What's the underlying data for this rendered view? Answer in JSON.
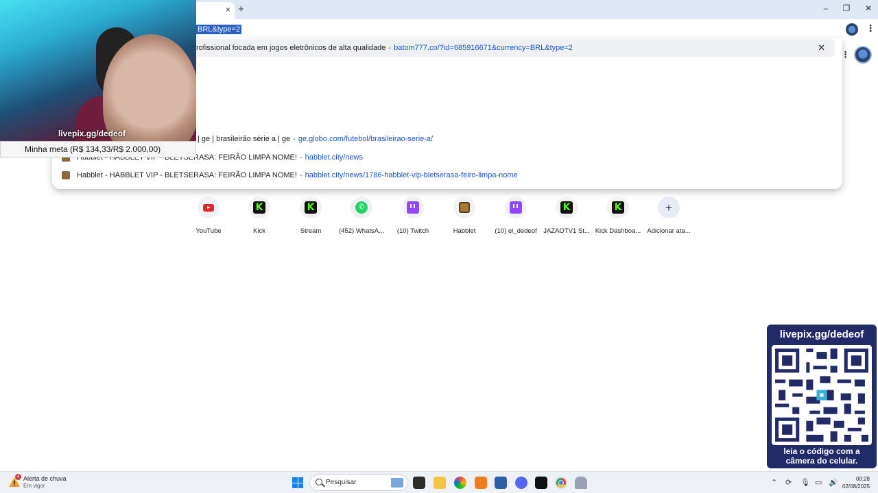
{
  "browser": {
    "omnibox_text": "BRL&type=2",
    "controls": {
      "new_tab": "+",
      "tab_close": "×",
      "minimize": "–",
      "restore": "❐",
      "close": "✕"
    }
  },
  "suggestions": [
    {
      "text": "rofissional focada em jogos eletrônicos de alta qualidade",
      "url": "batom777.co/?id=685916671&currency=BRL&type=2",
      "highlight": true
    },
    {
      "text": "| ge | brasileirão série a | ge",
      "url": "ge.globo.com/futebol/brasileirao-serie-a/"
    },
    {
      "text": "Habblet - HABBLET VIP - BLETSERASA: FEIRÃO LIMPA NOME!",
      "url": "habblet.city/news"
    },
    {
      "text": "Habblet - HABBLET VIP - BLETSERASA: FEIRÃO LIMPA NOME!",
      "url": "habblet.city/news/1786-habblet-vip-bletserasa-feiro-limpa-nome"
    }
  ],
  "shortcuts": [
    {
      "label": "YouTube",
      "icon": "youtube-icon"
    },
    {
      "label": "Kick",
      "icon": "kick-icon"
    },
    {
      "label": "Stream",
      "icon": "kick-icon"
    },
    {
      "label": "(452) WhatsA...",
      "icon": "whatsapp-icon"
    },
    {
      "label": "(10) Twitch",
      "icon": "twitch-icon"
    },
    {
      "label": "Habblet",
      "icon": "habblet-icon"
    },
    {
      "label": "(10) el_dedeof",
      "icon": "twitch-icon"
    },
    {
      "label": "JAZAOTV1 St...",
      "icon": "kick-icon"
    },
    {
      "label": "Kick Dashboa...",
      "icon": "kick-icon"
    },
    {
      "label": "Adicionar ata...",
      "icon": "plus-icon"
    }
  ],
  "overlay": {
    "cam_label": "livepix.gg/dedeof",
    "goal": "Minha meta (R$ 134,33/R$ 2.000,00)",
    "qr_title": "livepix.gg/dedeof",
    "qr_caption_1": "leia o código com a",
    "qr_caption_2": "câmera do celular."
  },
  "taskbar": {
    "weather_badge": "4",
    "weather_title": "Alerta de chuva",
    "weather_sub": "Em vigor",
    "search_placeholder": "Pesquisar",
    "time": "00:28",
    "date": "02/08/2025"
  },
  "colors": {
    "accent": "#1a56c4",
    "qr_bg": "#232a68",
    "kick": "#53fc18"
  }
}
